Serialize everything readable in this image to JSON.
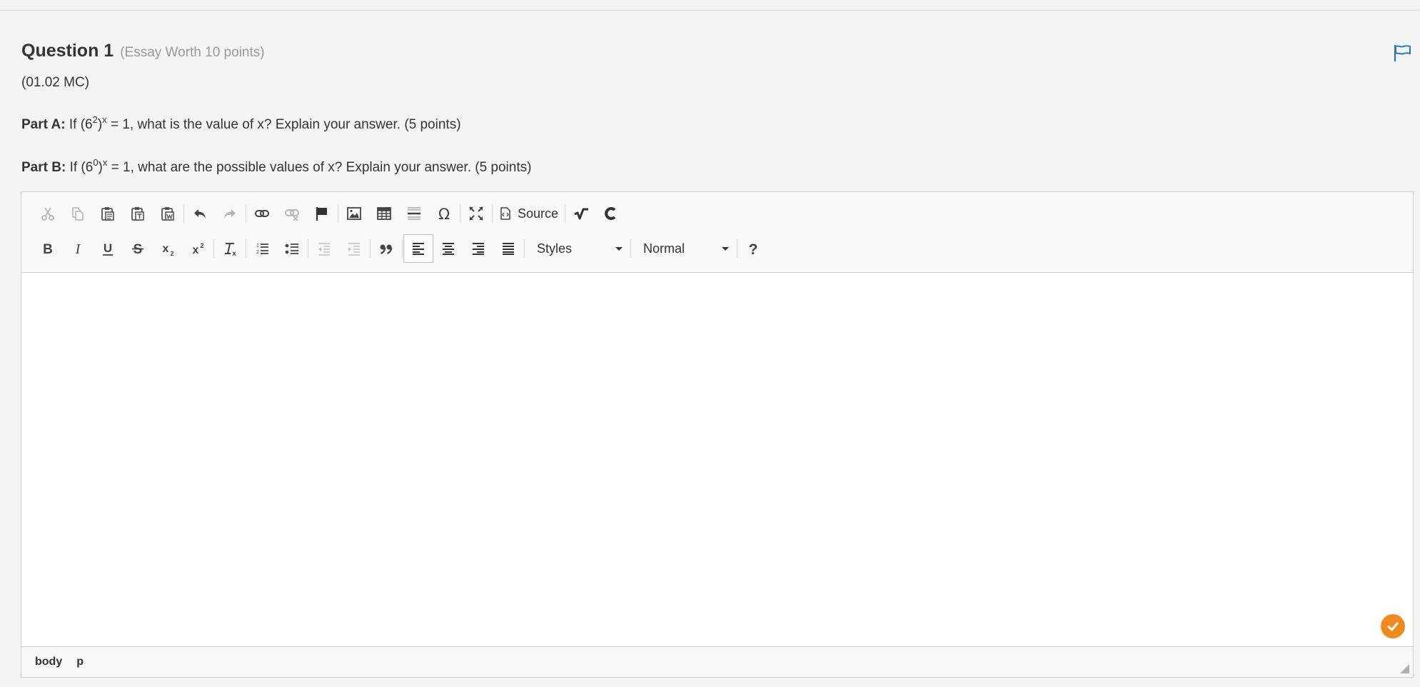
{
  "question": {
    "title": "Question 1",
    "worth": "(Essay Worth 10 points)",
    "code": "(01.02 MC)",
    "part_a": {
      "label": "Part A:",
      "pre": " If (6",
      "exp": "2",
      "mid": ")",
      "exp2": "x",
      "post": " = 1, what is the value of x? Explain your answer. (5 points)"
    },
    "part_b": {
      "label": "Part B:",
      "pre": " If (6",
      "exp": "0",
      "mid": ")",
      "exp2": "x",
      "post": " = 1, what are the possible values of x? Explain your answer. (5 points)"
    }
  },
  "editor": {
    "toolbar_row1": [
      "cut-icon",
      "copy-icon",
      "paste-icon",
      "paste-text-icon",
      "paste-word-icon",
      "undo-icon",
      "redo-icon",
      "link-icon",
      "unlink-icon",
      "anchor-icon",
      "image-icon",
      "table-icon",
      "horizontal-line-icon",
      "special-char-icon",
      "maximize-icon",
      "source-icon",
      "math-icon",
      "chemistry-icon"
    ],
    "toolbar_row2": [
      "bold-icon",
      "italic-icon",
      "underline-icon",
      "strike-icon",
      "subscript-icon",
      "superscript-icon",
      "remove-format-icon",
      "numbered-list-icon",
      "bulleted-list-icon",
      "outdent-icon",
      "indent-icon",
      "blockquote-icon",
      "align-left-icon",
      "align-center-icon",
      "align-right-icon",
      "align-justify-icon",
      "help-icon"
    ],
    "source_label": "Source",
    "styles_label": "Styles",
    "format_label": "Normal",
    "path": [
      "body",
      "p"
    ],
    "accent_color": "#f08a1c",
    "flag_color": "#2a7ab0"
  }
}
